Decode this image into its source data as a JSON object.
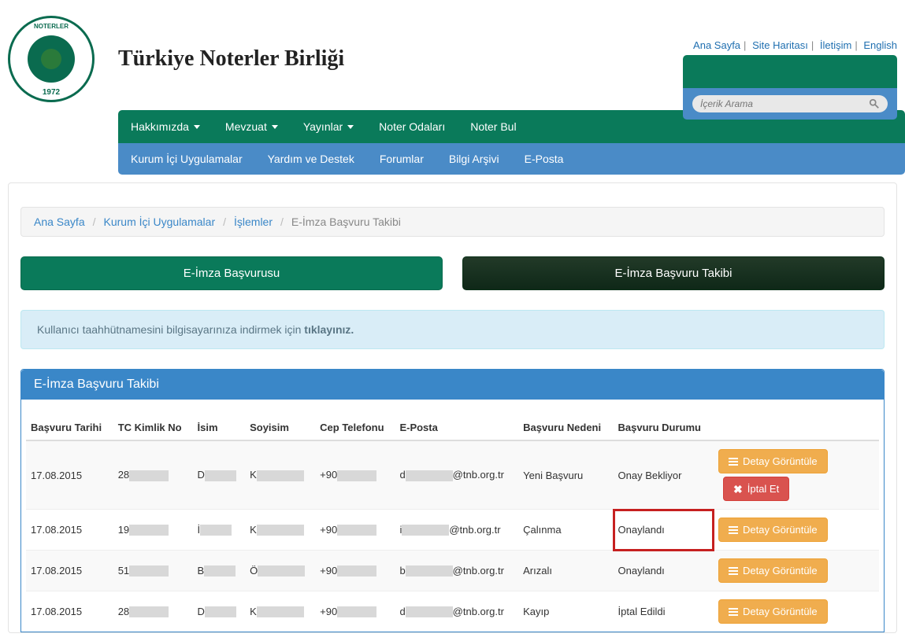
{
  "header": {
    "title": "Türkiye Noterler Birliği",
    "logo": {
      "ring_top": "NOTERLER",
      "ring_bottom": "1972"
    },
    "links": {
      "home": "Ana Sayfa",
      "sitemap": "Site Haritası",
      "contact": "İletişim",
      "english": "English"
    }
  },
  "nav_primary": [
    {
      "label": "Hakkımızda",
      "dropdown": true
    },
    {
      "label": "Mevzuat",
      "dropdown": true
    },
    {
      "label": "Yayınlar",
      "dropdown": true
    },
    {
      "label": "Noter Odaları",
      "dropdown": false
    },
    {
      "label": "Noter Bul",
      "dropdown": false
    }
  ],
  "nav_secondary": [
    "Kurum İçi Uygulamalar",
    "Yardım ve Destek",
    "Forumlar",
    "Bilgi Arşivi",
    "E-Posta"
  ],
  "search": {
    "placeholder": "İçerik Arama"
  },
  "breadcrumb": {
    "items": [
      "Ana Sayfa",
      "Kurum İçi Uygulamalar",
      "İşlemler"
    ],
    "current": "E-İmza Başvuru Takibi"
  },
  "tabs": {
    "inactive": "E-İmza Başvurusu",
    "active": "E-İmza Başvuru Takibi"
  },
  "info": {
    "text": "Kullanıcı taahhütnamesini bilgisayarınıza indirmek için ",
    "link": "tıklayınız."
  },
  "panel": {
    "title": "E-İmza Başvuru Takibi"
  },
  "table": {
    "headers": [
      "Başvuru Tarihi",
      "TC Kimlik No",
      "İsim",
      "Soyisim",
      "Cep Telefonu",
      "E-Posta",
      "Başvuru Nedeni",
      "Başvuru Durumu"
    ],
    "actions": {
      "detail": "Detay Görüntüle",
      "cancel": "İptal Et"
    },
    "rows": [
      {
        "date": "17.08.2015",
        "tc": "28",
        "isim": "D",
        "soyisim": "K",
        "cep": "+90",
        "eposta_pre": "d",
        "eposta_post": "@tnb.org.tr",
        "neden": "Yeni Başvuru",
        "durum": "Onay Bekliyor",
        "highlight": false,
        "cancel": true
      },
      {
        "date": "17.08.2015",
        "tc": "19",
        "isim": "İ",
        "soyisim": "K",
        "cep": "+90",
        "eposta_pre": "i",
        "eposta_post": "@tnb.org.tr",
        "neden": "Çalınma",
        "durum": "Onaylandı",
        "highlight": true,
        "cancel": false
      },
      {
        "date": "17.08.2015",
        "tc": "51",
        "isim": "B",
        "soyisim": "Ö",
        "cep": "+90",
        "eposta_pre": "b",
        "eposta_post": "@tnb.org.tr",
        "neden": "Arızalı",
        "durum": "Onaylandı",
        "highlight": false,
        "cancel": false
      },
      {
        "date": "17.08.2015",
        "tc": "28",
        "isim": "D",
        "soyisim": "K",
        "cep": "+90",
        "eposta_pre": "d",
        "eposta_post": "@tnb.org.tr",
        "neden": "Kayıp",
        "durum": "İptal Edildi",
        "highlight": false,
        "cancel": false
      }
    ]
  }
}
